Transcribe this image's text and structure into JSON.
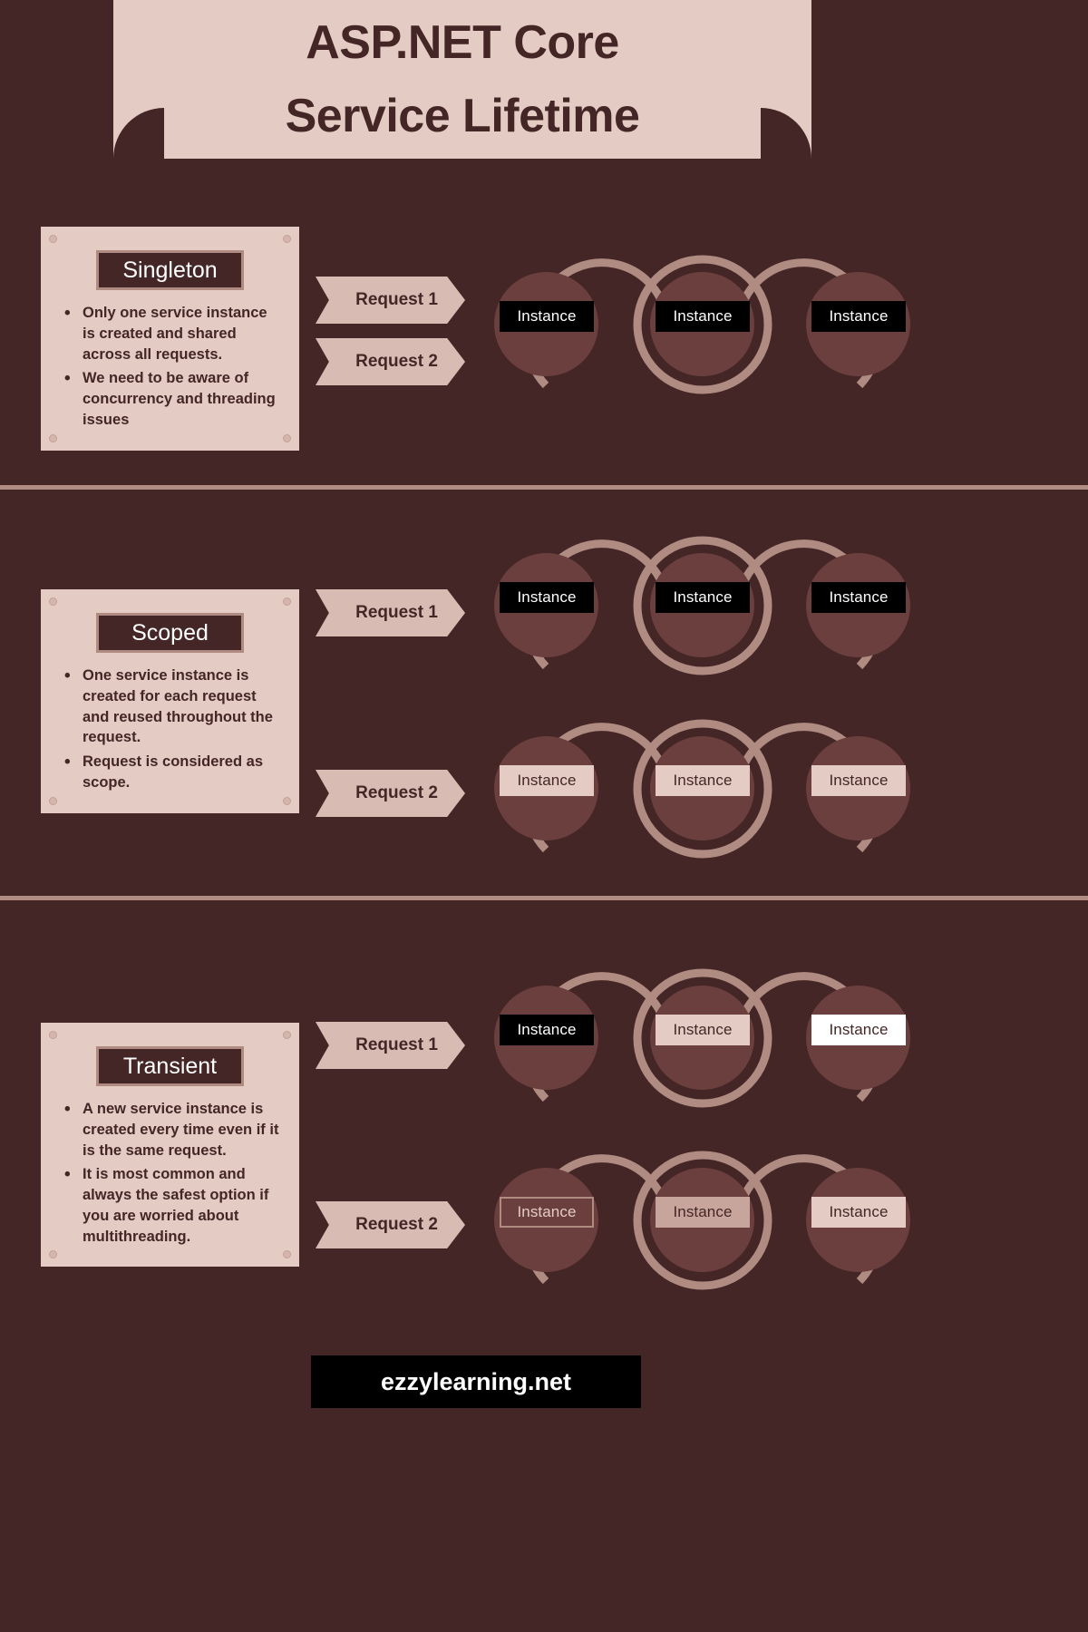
{
  "banner": {
    "title_line1": "ASP.NET Core",
    "title_line2": "Service Lifetime"
  },
  "colors": {
    "background": "#442626",
    "banner_bg": "#e4ccc4",
    "accent_mauve": "#b08b82",
    "node_fill": "#6b3f3d",
    "ribbon": "#d8bcb4",
    "instance_dark": "#000000",
    "instance_light": "#e4ccc4",
    "instance_white": "#ffffff"
  },
  "sections": [
    {
      "id": "singleton",
      "card": {
        "label": "Singleton",
        "bullets": [
          "Only one service instance is created and shared across all requests.",
          "We need to be aware of concurrency and threading issues"
        ]
      },
      "requests": [
        {
          "label": "Request 1"
        },
        {
          "label": "Request 2"
        }
      ],
      "chains": [
        {
          "instances": [
            {
              "text": "Instance",
              "style": "dark"
            },
            {
              "text": "Instance",
              "style": "dark"
            },
            {
              "text": "Instance",
              "style": "dark"
            }
          ]
        }
      ]
    },
    {
      "id": "scoped",
      "card": {
        "label": "Scoped",
        "bullets": [
          "One service instance is created for each request and reused throughout the request.",
          "Request is considered as scope."
        ]
      },
      "requests": [
        {
          "label": "Request 1"
        },
        {
          "label": "Request 2"
        }
      ],
      "chains": [
        {
          "instances": [
            {
              "text": "Instance",
              "style": "dark"
            },
            {
              "text": "Instance",
              "style": "dark"
            },
            {
              "text": "Instance",
              "style": "dark"
            }
          ]
        },
        {
          "instances": [
            {
              "text": "Instance",
              "style": "light"
            },
            {
              "text": "Instance",
              "style": "light"
            },
            {
              "text": "Instance",
              "style": "light"
            }
          ]
        }
      ]
    },
    {
      "id": "transient",
      "card": {
        "label": "Transient",
        "bullets": [
          "A new service instance is created every time even if it is the same request.",
          "It is most common and always the safest option if you are worried about multithreading."
        ]
      },
      "requests": [
        {
          "label": "Request 1"
        },
        {
          "label": "Request 2"
        }
      ],
      "chains": [
        {
          "instances": [
            {
              "text": "Instance",
              "style": "dark"
            },
            {
              "text": "Instance",
              "style": "light"
            },
            {
              "text": "Instance",
              "style": "white"
            }
          ]
        },
        {
          "instances": [
            {
              "text": "Instance",
              "style": "outline"
            },
            {
              "text": "Instance",
              "style": "mauve"
            },
            {
              "text": "Instance",
              "style": "light"
            }
          ]
        }
      ]
    }
  ],
  "footer": {
    "text": "ezzylearning.net"
  }
}
